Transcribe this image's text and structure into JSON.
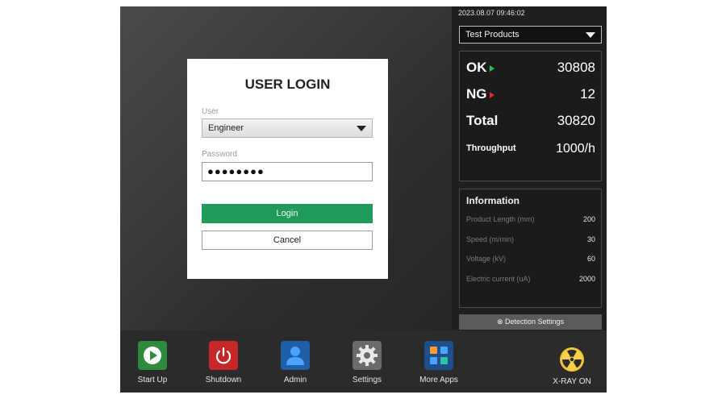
{
  "main": {
    "login": {
      "title": "USER LOGIN",
      "user_label": "User",
      "user_value": "Engineer",
      "password_label": "Password",
      "password_value": "●●●●●●●●",
      "login_label": "Login",
      "cancel_label": "Cancel"
    }
  },
  "right_panel": {
    "datetime": "2023.08.07  09:46:02",
    "product_select": "Test Products",
    "stats": {
      "ok_label": "OK",
      "ok_value": "30808",
      "ng_label": "NG",
      "ng_value": "12",
      "total_label": "Total",
      "total_value": "30820",
      "throughput_label": "Throughput",
      "throughput_value": "1000/h"
    },
    "information": {
      "title": "Information",
      "rows": [
        {
          "label": "Product Length (mm)",
          "value": "200"
        },
        {
          "label": "Speed (m/min)",
          "value": "30"
        },
        {
          "label": "Voltage (kV)",
          "value": "60"
        },
        {
          "label": "Electric current (uA)",
          "value": "2000"
        }
      ]
    },
    "detection_settings_label": "⊗ Detection Settings"
  },
  "bottom_bar": {
    "apps": [
      {
        "label": "Start Up",
        "icon": "play-icon",
        "color": "#2e8b3e"
      },
      {
        "label": "Shutdown",
        "icon": "power-icon",
        "color": "#c62828"
      },
      {
        "label": "Admin",
        "icon": "user-icon",
        "color": "#1e5fa8"
      },
      {
        "label": "Settings",
        "icon": "gear-icon",
        "color": "#6b6b6b"
      },
      {
        "label": "More Apps",
        "icon": "apps-grid-icon",
        "color": "#1f4f8a"
      }
    ],
    "xray_label": "X-RAY ON",
    "xray_icon": "radiation-icon"
  },
  "colors": {
    "ok_arrow": "#27c24c",
    "ng_arrow": "#e02a2a",
    "login_button": "#1f9a5a"
  }
}
